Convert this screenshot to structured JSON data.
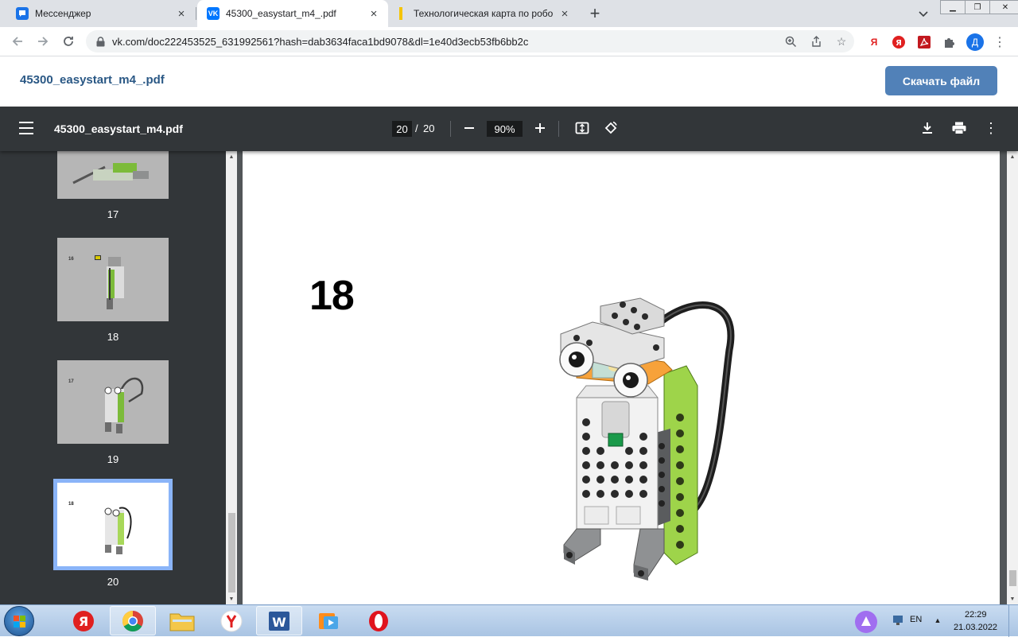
{
  "browser": {
    "tabs": [
      {
        "title": "Мессенджер",
        "favicon": "messenger-icon",
        "active": false
      },
      {
        "title": "45300_easystart_m4_.pdf",
        "favicon": "vk-icon",
        "active": true
      },
      {
        "title": "Технологическая карта по робо",
        "favicon": "yellow-doc-icon",
        "active": false
      }
    ],
    "new_tab": "+",
    "url": "vk.com/doc222453525_631992561?hash=dab3634faca1bd9078&dl=1e40d3ecb53fb6bb2c",
    "profile_initial": "Д",
    "ext_yandex": "Я"
  },
  "vk": {
    "doc_title": "45300_easystart_m4_.pdf",
    "download_label": "Скачать файл",
    "accent": "#5181b8"
  },
  "pdf": {
    "file_name": "45300_easystart_m4.pdf",
    "current_page": "20",
    "separator": "/",
    "total_pages": "20",
    "zoom": "90%",
    "thumbnails": [
      {
        "label": "17",
        "pnum": ""
      },
      {
        "label": "18",
        "pnum": "16"
      },
      {
        "label": "19",
        "pnum": "17"
      },
      {
        "label": "20",
        "pnum": "18",
        "selected": true
      }
    ],
    "step_number": "18"
  },
  "taskbar": {
    "language": "EN",
    "time": "22:29",
    "date": "21.03.2022",
    "yandex_letter": "Я",
    "word_letter": "W"
  }
}
